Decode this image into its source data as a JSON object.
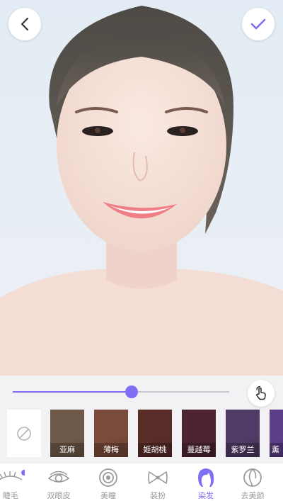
{
  "photo": {
    "background": "#e6edf4"
  },
  "intensity_slider": {
    "value": 0.55,
    "accent": "#7e6ef3"
  },
  "hair_colors": [
    {
      "label": "亚麻",
      "color": "#6f5a4a"
    },
    {
      "label": "薄梅",
      "color": "#7a4a3a"
    },
    {
      "label": "姬胡桃",
      "color": "#5a2c28"
    },
    {
      "label": "蔓越莓",
      "color": "#4f2432"
    },
    {
      "label": "紫罗兰",
      "color": "#4f3b66"
    },
    {
      "label": "薰",
      "color": "#5b3f88"
    }
  ],
  "bottom_nav": [
    {
      "label": "睫毛",
      "icon": "eyelash-icon",
      "active": false
    },
    {
      "label": "双眼皮",
      "icon": "eye-icon",
      "active": false
    },
    {
      "label": "美瞳",
      "icon": "contact-lens-icon",
      "active": false
    },
    {
      "label": "装扮",
      "icon": "bow-icon",
      "active": false
    },
    {
      "label": "染发",
      "icon": "hair-dye-icon",
      "active": true
    },
    {
      "label": "去美颜",
      "icon": "remove-makeup-icon",
      "active": false
    }
  ]
}
